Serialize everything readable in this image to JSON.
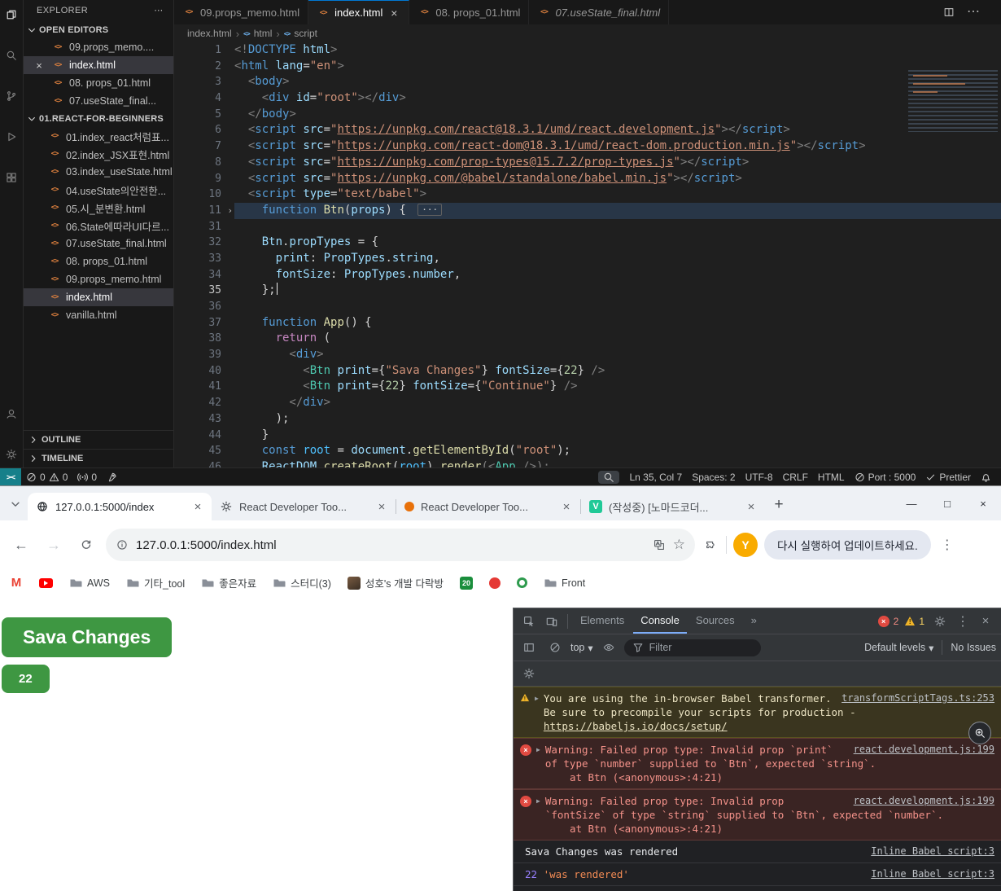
{
  "vscode": {
    "activity": {
      "top": [
        "files-icon",
        "search-icon",
        "source-control-icon",
        "run-debug-icon",
        "extensions-icon"
      ],
      "bottom": [
        "account-icon",
        "settings-gear-icon"
      ]
    },
    "explorer": {
      "title": "EXPLORER",
      "open_editors": {
        "label": "OPEN EDITORS",
        "items": [
          {
            "name": "09.props_memo...."
          },
          {
            "name": "index.html",
            "active": true
          },
          {
            "name": "08. props_01.html"
          },
          {
            "name": "07.useState_final..."
          }
        ]
      },
      "folder": {
        "label": "01.REACT-FOR-BEGINNERS",
        "files": [
          {
            "name": "01.index_react처럼표..."
          },
          {
            "name": "02.index_JSX표현.html"
          },
          {
            "name": "03.index_useState.html"
          },
          {
            "name": "04.useState의안전한..."
          },
          {
            "name": "05.시_분변환.html"
          },
          {
            "name": "06.State에따라UI다르..."
          },
          {
            "name": "07.useState_final.html"
          },
          {
            "name": "08. props_01.html"
          },
          {
            "name": "09.props_memo.html"
          },
          {
            "name": "index.html",
            "selected": true
          },
          {
            "name": "vanilla.html"
          }
        ]
      },
      "outline_label": "OUTLINE",
      "timeline_label": "TIMELINE"
    },
    "tabs": [
      {
        "label": "09.props_memo.html"
      },
      {
        "label": "index.html",
        "active": true
      },
      {
        "label": "08. props_01.html"
      },
      {
        "label": "07.useState_final.html",
        "preview": true
      }
    ],
    "breadcrumb": [
      "index.html",
      "html",
      "script"
    ],
    "code": {
      "fold_marker": "···",
      "lines": [
        {
          "n": "1",
          "s": [
            [
              "<!",
              "p"
            ],
            [
              "DOCTYPE",
              "t"
            ],
            [
              " html",
              "a"
            ],
            [
              ">",
              "p"
            ]
          ]
        },
        {
          "n": "2",
          "s": [
            [
              "<",
              "p"
            ],
            [
              "html",
              "t"
            ],
            [
              " ",
              "d"
            ],
            [
              "lang",
              "a"
            ],
            [
              "=",
              "d"
            ],
            [
              "\"en\"",
              "s"
            ],
            [
              ">",
              "p"
            ]
          ]
        },
        {
          "n": "3",
          "s": [
            [
              "  <",
              "p"
            ],
            [
              "body",
              "t"
            ],
            [
              ">",
              "p"
            ]
          ]
        },
        {
          "n": "4",
          "s": [
            [
              "    <",
              "p"
            ],
            [
              "div",
              "t"
            ],
            [
              " ",
              "d"
            ],
            [
              "id",
              "a"
            ],
            [
              "=",
              "d"
            ],
            [
              "\"root\"",
              "s"
            ],
            [
              "></",
              "p"
            ],
            [
              "div",
              "t"
            ],
            [
              ">",
              "p"
            ]
          ]
        },
        {
          "n": "5",
          "s": [
            [
              "  </",
              "p"
            ],
            [
              "body",
              "t"
            ],
            [
              ">",
              "p"
            ]
          ]
        },
        {
          "n": "6",
          "s": [
            [
              "  <",
              "p"
            ],
            [
              "script",
              "t"
            ],
            [
              " ",
              "d"
            ],
            [
              "src",
              "a"
            ],
            [
              "=",
              "d"
            ],
            [
              "\"",
              "s"
            ],
            [
              "https://unpkg.com/react@18.3.1/umd/react.development.js",
              "u"
            ],
            [
              "\"",
              "s"
            ],
            [
              "></",
              "p"
            ],
            [
              "script",
              "t"
            ],
            [
              ">",
              "p"
            ]
          ]
        },
        {
          "n": "7",
          "s": [
            [
              "  <",
              "p"
            ],
            [
              "script",
              "t"
            ],
            [
              " ",
              "d"
            ],
            [
              "src",
              "a"
            ],
            [
              "=",
              "d"
            ],
            [
              "\"",
              "s"
            ],
            [
              "https://unpkg.com/react-dom@18.3.1/umd/react-dom.production.min.js",
              "u"
            ],
            [
              "\"",
              "s"
            ],
            [
              "></",
              "p"
            ],
            [
              "script",
              "t"
            ],
            [
              ">",
              "p"
            ]
          ]
        },
        {
          "n": "8",
          "s": [
            [
              "  <",
              "p"
            ],
            [
              "script",
              "t"
            ],
            [
              " ",
              "d"
            ],
            [
              "src",
              "a"
            ],
            [
              "=",
              "d"
            ],
            [
              "\"",
              "s"
            ],
            [
              "https://unpkg.com/prop-types@15.7.2/prop-types.js",
              "u"
            ],
            [
              "\"",
              "s"
            ],
            [
              "></",
              "p"
            ],
            [
              "script",
              "t"
            ],
            [
              ">",
              "p"
            ]
          ]
        },
        {
          "n": "9",
          "s": [
            [
              "  <",
              "p"
            ],
            [
              "script",
              "t"
            ],
            [
              " ",
              "d"
            ],
            [
              "src",
              "a"
            ],
            [
              "=",
              "d"
            ],
            [
              "\"",
              "s"
            ],
            [
              "https://unpkg.com/@babel/standalone/babel.min.js",
              "u"
            ],
            [
              "\"",
              "s"
            ],
            [
              "></",
              "p"
            ],
            [
              "script",
              "t"
            ],
            [
              ">",
              "p"
            ]
          ]
        },
        {
          "n": "10",
          "s": [
            [
              "  <",
              "p"
            ],
            [
              "script",
              "t"
            ],
            [
              " ",
              "d"
            ],
            [
              "type",
              "a"
            ],
            [
              "=",
              "d"
            ],
            [
              "\"text/babel\"",
              "s"
            ],
            [
              ">",
              "p"
            ]
          ]
        },
        {
          "n": "11",
          "s": [
            [
              "    ",
              "d"
            ],
            [
              "function",
              "k"
            ],
            [
              " ",
              "d"
            ],
            [
              "Btn",
              "f"
            ],
            [
              "(",
              "d"
            ],
            [
              "props",
              "v"
            ],
            [
              ") { ",
              "d"
            ]
          ],
          "fold": true,
          "hl": true
        },
        {
          "n": "31",
          "s": []
        },
        {
          "n": "32",
          "s": [
            [
              "    ",
              "d"
            ],
            [
              "Btn",
              "v"
            ],
            [
              ".",
              "d"
            ],
            [
              "propTypes",
              "v"
            ],
            [
              " ",
              "d"
            ],
            [
              "=",
              "d"
            ],
            [
              " {",
              "d"
            ]
          ]
        },
        {
          "n": "33",
          "s": [
            [
              "      ",
              "d"
            ],
            [
              "print",
              "v"
            ],
            [
              ": ",
              "d"
            ],
            [
              "PropTypes",
              "v"
            ],
            [
              ".",
              "d"
            ],
            [
              "string",
              "v"
            ],
            [
              ",",
              "d"
            ]
          ]
        },
        {
          "n": "34",
          "s": [
            [
              "      ",
              "d"
            ],
            [
              "fontSize",
              "v"
            ],
            [
              ": ",
              "d"
            ],
            [
              "PropTypes",
              "v"
            ],
            [
              ".",
              "d"
            ],
            [
              "number",
              "v"
            ],
            [
              ",",
              "d"
            ]
          ]
        },
        {
          "n": "35",
          "s": [
            [
              "    };",
              "d"
            ]
          ],
          "caret": true,
          "cur": true
        },
        {
          "n": "36",
          "s": []
        },
        {
          "n": "37",
          "s": [
            [
              "    ",
              "d"
            ],
            [
              "function",
              "k"
            ],
            [
              " ",
              "d"
            ],
            [
              "App",
              "f"
            ],
            [
              "() {",
              "d"
            ]
          ]
        },
        {
          "n": "38",
          "s": [
            [
              "      ",
              "d"
            ],
            [
              "return",
              "c"
            ],
            [
              " (",
              "d"
            ]
          ]
        },
        {
          "n": "39",
          "s": [
            [
              "        <",
              "p"
            ],
            [
              "div",
              "t"
            ],
            [
              ">",
              "p"
            ]
          ]
        },
        {
          "n": "40",
          "s": [
            [
              "          <",
              "p"
            ],
            [
              "Btn",
              "m"
            ],
            [
              " ",
              "d"
            ],
            [
              "print",
              "a"
            ],
            [
              "=",
              "d"
            ],
            [
              "{",
              "d"
            ],
            [
              "\"Sava Changes\"",
              "s"
            ],
            [
              "}",
              "d"
            ],
            [
              " ",
              "d"
            ],
            [
              "fontSize",
              "a"
            ],
            [
              "=",
              "d"
            ],
            [
              "{",
              "d"
            ],
            [
              "22",
              "n"
            ],
            [
              "}",
              "d"
            ],
            [
              " />",
              "p"
            ]
          ]
        },
        {
          "n": "41",
          "s": [
            [
              "          <",
              "p"
            ],
            [
              "Btn",
              "m"
            ],
            [
              " ",
              "d"
            ],
            [
              "print",
              "a"
            ],
            [
              "=",
              "d"
            ],
            [
              "{",
              "d"
            ],
            [
              "22",
              "n"
            ],
            [
              "}",
              "d"
            ],
            [
              " ",
              "d"
            ],
            [
              "fontSize",
              "a"
            ],
            [
              "=",
              "d"
            ],
            [
              "{",
              "d"
            ],
            [
              "\"Continue\"",
              "s"
            ],
            [
              "}",
              "d"
            ],
            [
              " />",
              "p"
            ]
          ]
        },
        {
          "n": "42",
          "s": [
            [
              "        </",
              "p"
            ],
            [
              "div",
              "t"
            ],
            [
              ">",
              "p"
            ]
          ]
        },
        {
          "n": "43",
          "s": [
            [
              "      );",
              "d"
            ]
          ]
        },
        {
          "n": "44",
          "s": [
            [
              "    }",
              "d"
            ]
          ]
        },
        {
          "n": "45",
          "s": [
            [
              "    ",
              "d"
            ],
            [
              "const",
              "k"
            ],
            [
              " ",
              "d"
            ],
            [
              "root",
              "cv"
            ],
            [
              " ",
              "d"
            ],
            [
              "=",
              "d"
            ],
            [
              " ",
              "d"
            ],
            [
              "document",
              "v"
            ],
            [
              ".",
              "d"
            ],
            [
              "getElementById",
              "f"
            ],
            [
              "(",
              "d"
            ],
            [
              "\"root\"",
              "s"
            ],
            [
              ");",
              "d"
            ]
          ]
        },
        {
          "n": "46",
          "s": [
            [
              "    ",
              "d"
            ],
            [
              "ReactDOM",
              "v"
            ],
            [
              ".",
              "d"
            ],
            [
              "createRoot",
              "f"
            ],
            [
              "(",
              "d"
            ],
            [
              "root",
              "cv"
            ],
            [
              ")",
              "d"
            ],
            [
              ".",
              "d"
            ],
            [
              "render",
              "f"
            ],
            [
              "(<",
              "p"
            ],
            [
              "App",
              "m"
            ],
            [
              " />);",
              "p"
            ]
          ]
        }
      ]
    },
    "status": {
      "errors": "0",
      "warnings": "0",
      "ports": "0",
      "line_col": "Ln 35, Col 7",
      "spaces": "Spaces: 2",
      "encoding": "UTF-8",
      "eol": "CRLF",
      "language": "HTML",
      "port": "Port : 5000",
      "formatter": "Prettier"
    }
  },
  "chrome": {
    "tabs": [
      {
        "title": "127.0.0.1:5000/index",
        "favicon": "globe-favicon",
        "active": true
      },
      {
        "title": "React Developer Too...",
        "favicon": "gear-favicon"
      },
      {
        "title": "React Developer Too...",
        "favicon": "orange-favicon"
      },
      {
        "title": "(작성중) [노마드코더...",
        "favicon": "velog-favicon"
      }
    ],
    "url": "127.0.0.1:5000/index.html",
    "update_button": "다시 실행하여 업데이트하세요.",
    "profile_initial": "Y",
    "bookmarks": [
      {
        "icon": "gmail-icon"
      },
      {
        "icon": "youtube-icon"
      },
      {
        "icon": "folder-icon",
        "label": "AWS"
      },
      {
        "icon": "folder-icon",
        "label": "기타_tool"
      },
      {
        "icon": "folder-icon",
        "label": "좋은자료"
      },
      {
        "icon": "folder-icon",
        "label": "스터디(3)"
      },
      {
        "icon": "avatar-favicon",
        "label": "성호's 개발 다락방"
      },
      {
        "icon": "badge-20-icon",
        "badge_text": "20"
      },
      {
        "icon": "tomato-icon"
      },
      {
        "icon": "ring-icon"
      },
      {
        "icon": "folder-icon",
        "label": "Front"
      }
    ]
  },
  "page": {
    "button_color": "#3e9742",
    "buttons": [
      {
        "label": "Sava Changes",
        "size": "big"
      },
      {
        "label": "22",
        "size": "small"
      }
    ]
  },
  "devtools": {
    "tabs": [
      "Elements",
      "Console",
      "Sources"
    ],
    "active_tab": "Console",
    "error_count": "2",
    "warning_count": "1",
    "toolbar": {
      "context": "top",
      "filter_placeholder": "Filter",
      "levels": "Default levels",
      "issues": "No Issues"
    },
    "messages": [
      {
        "type": "warning",
        "text": "You are using the in-browser Babel transformer. Be sure to precompile your scripts for production - ",
        "link_text": "https://babeljs.io/docs/setup/",
        "source": "transformScriptTags.ts:253"
      },
      {
        "type": "error",
        "text": "Warning: Failed prop type: Invalid prop `print` of type `number` supplied to `Btn`, expected `string`.",
        "stack": "    at Btn (<anonymous>:4:21)",
        "source": "react.development.js:199"
      },
      {
        "type": "error",
        "text": "Warning: Failed prop type: Invalid prop `fontSize` of type `string` supplied to `Btn`, expected `number`.",
        "stack": "    at Btn (<anonymous>:4:21)",
        "source": "react.development.js:199"
      },
      {
        "type": "log",
        "parts": [
          {
            "text": "Sava Changes was rendered"
          }
        ],
        "source": "Inline Babel script:3"
      },
      {
        "type": "log",
        "parts": [
          {
            "text": "22",
            "style": "number"
          },
          {
            "text": " "
          },
          {
            "text": "'was rendered'",
            "style": "string"
          }
        ],
        "source": "Inline Babel script:3"
      }
    ]
  }
}
